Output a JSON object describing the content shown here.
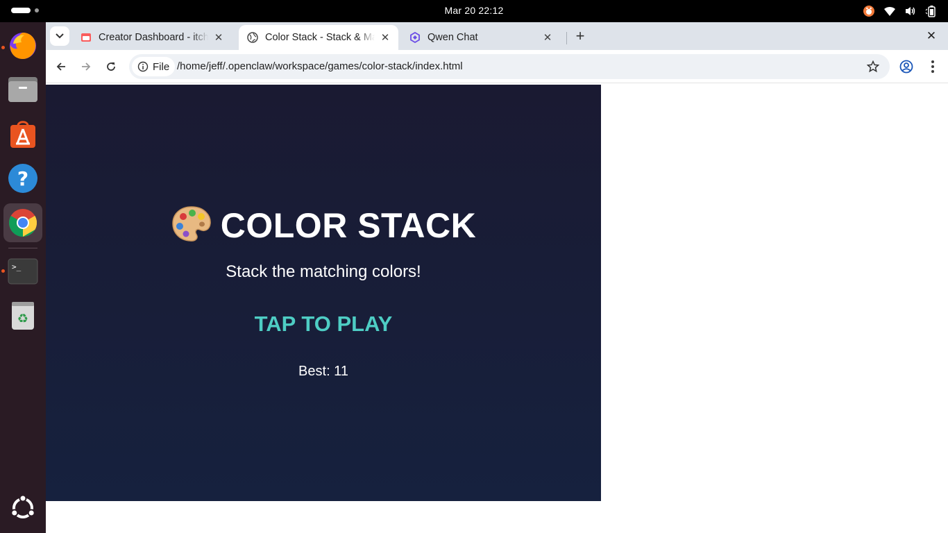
{
  "system": {
    "clock": "Mar 20  22:12",
    "tray_icons": [
      "cat-indicator-icon",
      "wifi-icon",
      "volume-icon",
      "battery-icon"
    ]
  },
  "dock": {
    "items": [
      "firefox-icon",
      "files-icon",
      "app-center-icon",
      "help-icon",
      "chrome-icon",
      "terminal-icon",
      "trash-icon",
      "show-apps-icon"
    ]
  },
  "browser": {
    "tabs": [
      {
        "label": "Creator Dashboard - itch.io",
        "favicon": "itchio-icon"
      },
      {
        "label": "Color Stack - Stack & Match",
        "favicon": "globe-icon"
      },
      {
        "label": "Qwen Chat",
        "favicon": "qwen-icon"
      }
    ],
    "new_tab": "+",
    "omnibox": {
      "chip_label": "File",
      "url": "/home/jeff/.openclaw/workspace/games/color-stack/index.html"
    }
  },
  "game": {
    "emoji": "🎨",
    "title": "COLOR STACK",
    "subtitle": "Stack the matching colors!",
    "play_label": "TAP TO PLAY",
    "best_label": "Best: 11",
    "colors": {
      "background_top": "#1a1a32",
      "background_bottom": "#16213e",
      "accent": "#4ecdc4"
    }
  }
}
